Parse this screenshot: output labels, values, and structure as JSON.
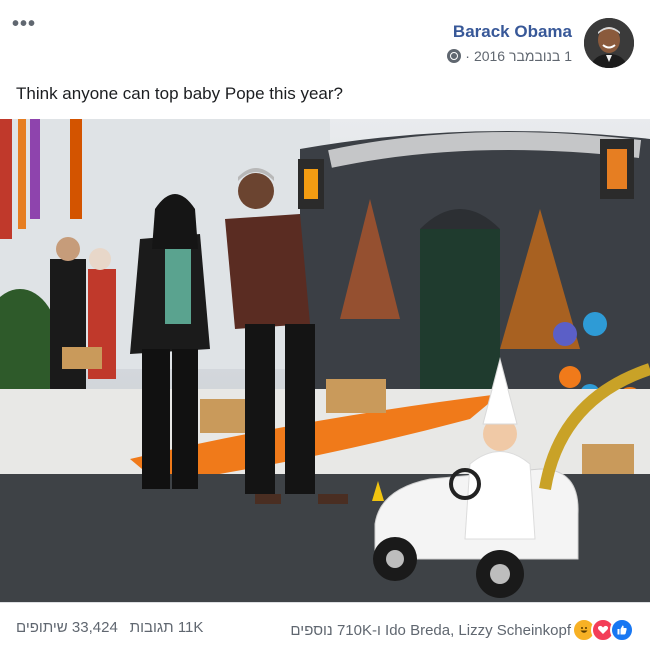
{
  "post": {
    "author": "Barack Obama",
    "date": "1 בנובמבר 2016",
    "meta_separator": "·",
    "more_options_label": "•••",
    "caption": "Think anyone can top baby Pope this year?"
  },
  "footer": {
    "reactors_text": "Ido Breda, Lizzy Scheinkopf ו-710K נוספים",
    "comments_text": "11K תגובות",
    "shares_text": "33,424 שיתופים"
  },
  "icons": [
    "globe-icon",
    "like-icon",
    "love-icon",
    "haha-icon"
  ],
  "colors": {
    "author_blue": "#385898",
    "like_blue": "#1877f2",
    "love_red": "#f33e58",
    "haha_yellow": "#f7b125",
    "pumpkin_orange": "#f07a1a"
  }
}
